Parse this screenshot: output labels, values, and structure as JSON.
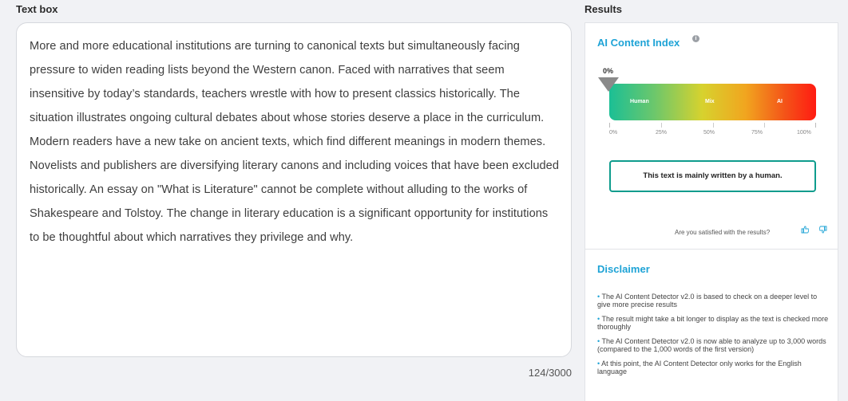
{
  "textbox": {
    "heading": "Text box",
    "content": "More and more educational institutions are turning to canonical texts but simultaneously facing pressure to widen reading lists beyond the Western canon. Faced with narratives that seem insensitive by today’s standards, teachers wrestle with how to present classics historically. The situation illustrates ongoing cultural debates about whose stories deserve a place in the curriculum. Modern readers have a new take on ancient texts, which find different meanings in modern themes. Novelists and publishers are diversifying literary canons and including voices that have been excluded historically. An essay on \"What is Literature\" cannot be complete without alluding to the works of Shakespeare and Tolstoy. The change in literary education is a significant opportunity for institutions to be thoughtful about which narratives they privilege and why.",
    "word_count": "124/3000"
  },
  "results": {
    "heading": "Results",
    "index_title": "AI Content Index",
    "info_icon": "i",
    "score_label": "0%",
    "score_fraction": 0,
    "gauge_labels": {
      "human": "Human",
      "mix": "Mix",
      "ai": "AI"
    },
    "tick_labels": [
      "0%",
      "25%",
      "50%",
      "75%",
      "100%"
    ],
    "verdict": "This text is mainly written by a human.",
    "satisfied_prompt": "Are you satisfied with the results?",
    "thumbs_up_icon": "thumbs-up-icon",
    "thumbs_down_icon": "thumbs-down-icon"
  },
  "disclaimer": {
    "title": "Disclaimer",
    "items": [
      "The AI Content Detector v2.0 is based to check on a deeper level to give more precise results",
      "The result might take a bit longer to display as the text is checked more thoroughly",
      "The AI Content Detector v2.0 is now able to analyze up to 3,000 words (compared to the 1,000 words of the first version)",
      "At this point, the AI Content Detector only works for the English language"
    ]
  },
  "colors": {
    "accent": "#1ea3d6",
    "verdict_border": "#0e9c8d",
    "gauge_human": "#1bbf95",
    "gauge_mix": "#d7d22e",
    "gauge_ai": "#ff1b12"
  }
}
